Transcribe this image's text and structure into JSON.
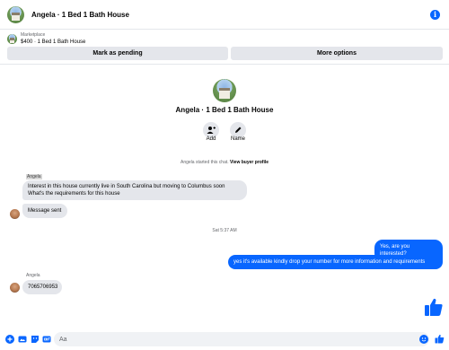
{
  "header": {
    "title": "Angela · 1 Bed 1 Bath House",
    "info_icon": "info-icon"
  },
  "marketplace": {
    "label": "Marketplace",
    "listing": "$400 · 1 Bed 1 Bath House"
  },
  "actions": {
    "pending_label": "Mark as pending",
    "more_label": "More options"
  },
  "profile": {
    "name": "Angela · 1 Bed 1 Bath House",
    "add_label": "Add",
    "name_label": "Name"
  },
  "chat_started": {
    "text": "Angela started this chat.",
    "link": "View buyer profile"
  },
  "messages": [
    {
      "sender": "Angela",
      "lines": [
        "Interest in this house currently live in South Carolina but moving to Columbus soon",
        "What's the requirements for this house"
      ]
    },
    {
      "text": "Message sent"
    },
    {
      "timestamp": "Sat 5:37 AM"
    },
    {
      "text": "Yes, are you interested?"
    },
    {
      "text": "yes it's available kindly drop your number for more information and requirements"
    },
    {
      "sender": "Angela",
      "text": "7065706953"
    }
  ],
  "composer": {
    "placeholder": "Aa"
  },
  "colors": {
    "accent": "#0866ff",
    "bubble_in": "#e4e6eb",
    "muted_text": "#65676b"
  }
}
